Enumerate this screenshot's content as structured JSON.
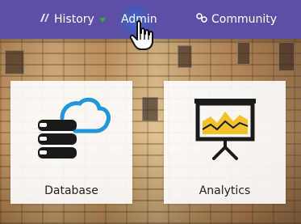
{
  "nav": {
    "history_label": "History",
    "admin_label": "Admin",
    "community_label": "Community",
    "history_icon": "history-icon",
    "community_icon": "community-icon"
  },
  "cards": {
    "database_label": "Database",
    "analytics_label": "Analytics",
    "database_icon": "database-cloud-icon",
    "analytics_icon": "presentation-chart-icon"
  },
  "colors": {
    "navbar": "#5d4fa6",
    "caret_green": "#3fa636",
    "icon_blue": "#2196d9",
    "icon_dark": "#1a1a1a",
    "chart_yellow": "#f2c12e"
  }
}
